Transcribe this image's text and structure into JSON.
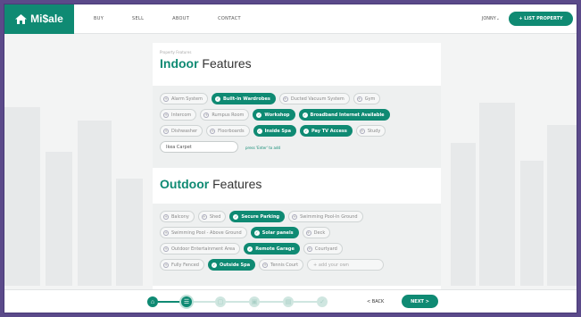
{
  "nav": {
    "brand": "Mi$ale",
    "links": [
      "BUY",
      "SELL",
      "ABOUT",
      "CONTACT"
    ],
    "user": "JONNY",
    "list_property": "+ LIST PROPERTY"
  },
  "indoor": {
    "crumb": "Property Features",
    "title_bold": "Indoor",
    "title_rest": " Features",
    "rows": [
      [
        {
          "label": "Alarm System",
          "on": false
        },
        {
          "label": "Built-in Wardrobes",
          "on": true
        },
        {
          "label": "Ducted Vacuum System",
          "on": false
        },
        {
          "label": "Gym",
          "on": false
        }
      ],
      [
        {
          "label": "Intercom",
          "on": false
        },
        {
          "label": "Rumpus Room",
          "on": false
        },
        {
          "label": "Workshop",
          "on": true
        },
        {
          "label": "Broadband Internet Available",
          "on": true
        }
      ],
      [
        {
          "label": "Dishwasher",
          "on": false
        },
        {
          "label": "Floorboards",
          "on": false
        },
        {
          "label": "Inside Spa",
          "on": true
        },
        {
          "label": "Pay TV Access",
          "on": true
        },
        {
          "label": "Study",
          "on": false
        }
      ]
    ],
    "input_value": "Ikea Carpet",
    "input_hint": "press 'Enter' to add"
  },
  "outdoor": {
    "title_bold": "Outdoor",
    "title_rest": " Features",
    "rows": [
      [
        {
          "label": "Balcony",
          "on": false
        },
        {
          "label": "Shed",
          "on": false
        },
        {
          "label": "Secure Parking",
          "on": true
        },
        {
          "label": "Swimming Pool-In Ground",
          "on": false
        }
      ],
      [
        {
          "label": "Swimming Pool - Above Ground",
          "on": false
        },
        {
          "label": "Solar panels",
          "on": true
        },
        {
          "label": "Deck",
          "on": false
        }
      ],
      [
        {
          "label": "Outdoor Entertainment Area",
          "on": false
        },
        {
          "label": "Remote Garage",
          "on": true
        },
        {
          "label": "Courtyard",
          "on": false
        }
      ],
      [
        {
          "label": "Fully Fenced",
          "on": false
        },
        {
          "label": "Outside Spa",
          "on": true
        },
        {
          "label": "Tennis Court",
          "on": false
        }
      ]
    ],
    "add_placeholder": "+ add your own"
  },
  "footer": {
    "back": "< BACK",
    "next": "NEXT >",
    "steps_total": 6,
    "steps_done": 2
  },
  "colors": {
    "accent": "#0f8a73",
    "frame": "#5b4a8a"
  }
}
